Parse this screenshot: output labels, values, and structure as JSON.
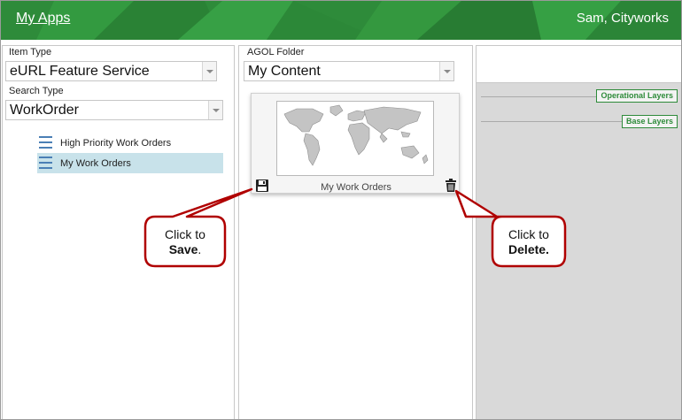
{
  "header": {
    "app_link": "My Apps",
    "user": "Sam, Cityworks",
    "color": "#2e8b3a"
  },
  "left_panel": {
    "item_type_label": "Item Type",
    "item_type_value": "eURL Feature Service",
    "search_type_label": "Search Type",
    "search_type_value": "WorkOrder",
    "items": [
      {
        "label": "High Priority Work Orders",
        "selected": false
      },
      {
        "label": "My Work Orders",
        "selected": true
      }
    ]
  },
  "middle_panel": {
    "folder_label": "AGOL Folder",
    "folder_value": "My Content",
    "card": {
      "title": "My Work Orders",
      "save_icon": "floppy-disk-icon",
      "delete_icon": "trash-icon"
    }
  },
  "right_panel": {
    "operational_layers": "Operational Layers",
    "base_layers": "Base Layers"
  },
  "callouts": {
    "save": {
      "line1": "Click to",
      "line2": "Save",
      "suffix": "."
    },
    "delete": {
      "line1": "Click to",
      "line2": "Delete."
    }
  }
}
